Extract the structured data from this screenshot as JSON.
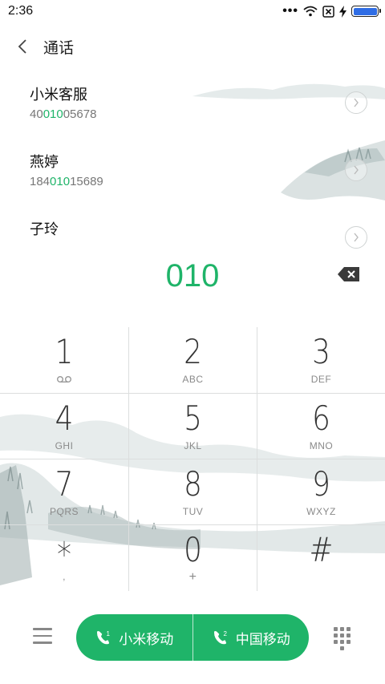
{
  "status_bar": {
    "time": "2:36",
    "dots": "•••",
    "battery_level": 1.0,
    "battery_color": "#2f6de5"
  },
  "header": {
    "title": "通话",
    "back_icon": "chevron-left-icon"
  },
  "contacts": [
    {
      "name": "小米客服",
      "number_pre": "40",
      "number_match": "010",
      "number_post": "05678"
    },
    {
      "name": "燕婷",
      "number_pre": "184",
      "number_match": "010",
      "number_post": "15689"
    },
    {
      "name": "子玲",
      "number_pre": "",
      "number_match": "",
      "number_post": ""
    }
  ],
  "dial": {
    "number": "010",
    "backspace_icon": "backspace-icon"
  },
  "keypad": [
    {
      "digit": "1",
      "letters": "",
      "sub_icon": "voicemail-icon"
    },
    {
      "digit": "2",
      "letters": "ABC"
    },
    {
      "digit": "3",
      "letters": "DEF"
    },
    {
      "digit": "4",
      "letters": "GHI"
    },
    {
      "digit": "5",
      "letters": "JKL"
    },
    {
      "digit": "6",
      "letters": "MNO"
    },
    {
      "digit": "7",
      "letters": "PQRS"
    },
    {
      "digit": "8",
      "letters": "TUV"
    },
    {
      "digit": "9",
      "letters": "WXYZ"
    },
    {
      "digit": "*",
      "letters": ","
    },
    {
      "digit": "0",
      "letters": "+"
    },
    {
      "digit": "#",
      "letters": ""
    }
  ],
  "bottom_bar": {
    "sim1_badge": "1",
    "sim1_label": "小米移动",
    "sim2_badge": "2",
    "sim2_label": "中国移动",
    "accent_color": "#1fb469"
  }
}
